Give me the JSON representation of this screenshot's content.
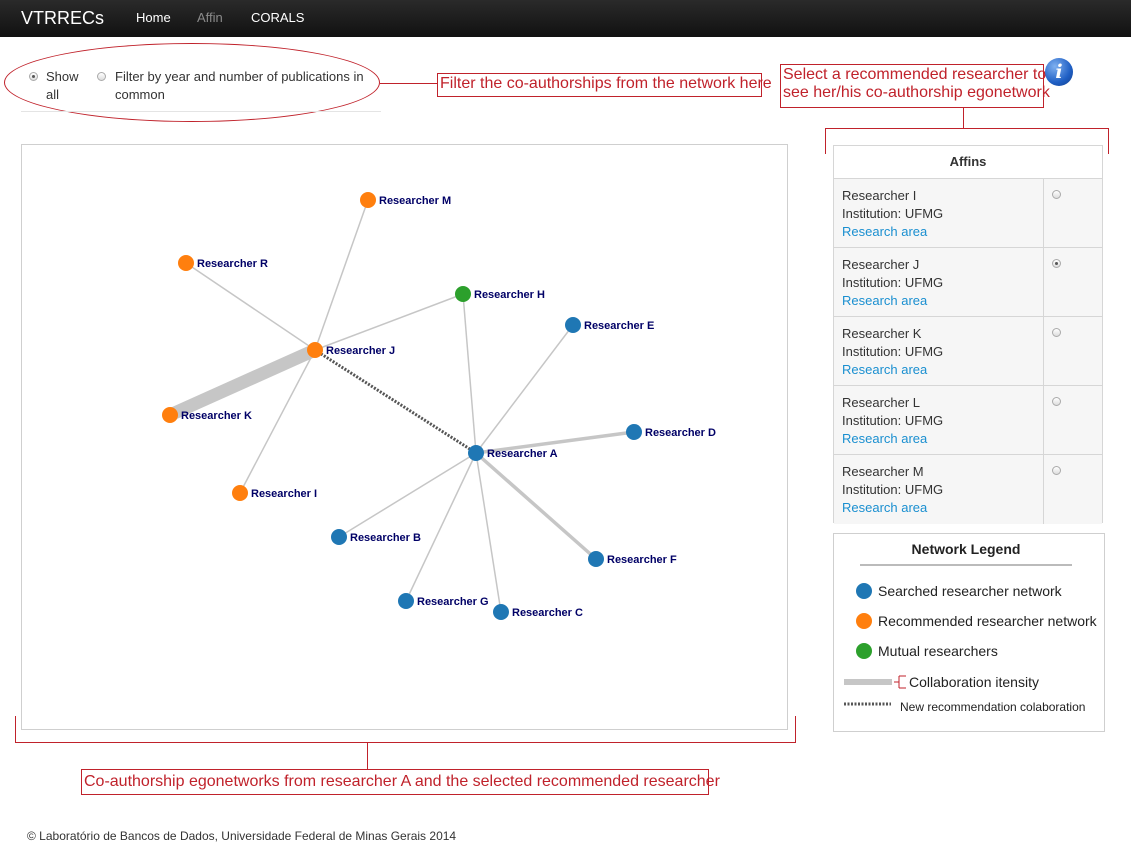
{
  "navbar": {
    "brand": "VTRRECs",
    "links": [
      {
        "label": "Home",
        "active": true
      },
      {
        "label": "Affin",
        "active": false
      },
      {
        "label": "CORALS",
        "active": true
      }
    ]
  },
  "filter": {
    "show_all_label_1": "Show",
    "show_all_label_2": "all",
    "filter_label_1": "Filter by year and number of publications in",
    "filter_label_2": "common",
    "selected": "show_all"
  },
  "annotations": {
    "filter_note": "Filter the co-authorships from the network here",
    "select_note_1": "Select a recommended researcher to",
    "select_note_2": "see her/his co-authorship egonetwork",
    "network_note": "Co-authorship egonetworks from researcher A and the selected recommended researcher"
  },
  "info_icon": {
    "glyph": "i",
    "icon": "info-icon"
  },
  "affins": {
    "title": "Affins",
    "rows": [
      {
        "name": "Researcher I",
        "institution": "Institution: UFMG",
        "area": "Research area",
        "selected": false
      },
      {
        "name": "Researcher J",
        "institution": "Institution: UFMG",
        "area": "Research area",
        "selected": true
      },
      {
        "name": "Researcher K",
        "institution": "Institution: UFMG",
        "area": "Research area",
        "selected": false
      },
      {
        "name": "Researcher L",
        "institution": "Institution: UFMG",
        "area": "Research area",
        "selected": false
      },
      {
        "name": "Researcher M",
        "institution": "Institution: UFMG",
        "area": "Research area",
        "selected": false
      }
    ]
  },
  "legend": {
    "title": "Network Legend",
    "searched": "Searched researcher network",
    "recommended": "Recommended researcher network",
    "mutual": "Mutual researchers",
    "intensity": "Collaboration itensity",
    "new_collab": "New recommendation colaboration"
  },
  "colors": {
    "searched": "#1f77b4",
    "recommended": "#ff7f0e",
    "mutual": "#2ca02c",
    "edge": "#c6c6c6",
    "recommendation_edge": "#555555",
    "annotation": "#c0222b",
    "label": "#000066"
  },
  "network": {
    "nodes": [
      {
        "id": "A",
        "label": "Researcher A",
        "group": "searched"
      },
      {
        "id": "B",
        "label": "Researcher B",
        "group": "searched"
      },
      {
        "id": "C",
        "label": "Researcher C",
        "group": "searched"
      },
      {
        "id": "D",
        "label": "Researcher D",
        "group": "searched"
      },
      {
        "id": "E",
        "label": "Researcher E",
        "group": "searched"
      },
      {
        "id": "F",
        "label": "Researcher F",
        "group": "searched"
      },
      {
        "id": "G",
        "label": "Researcher G",
        "group": "searched"
      },
      {
        "id": "H",
        "label": "Researcher H",
        "group": "mutual"
      },
      {
        "id": "I",
        "label": "Researcher I",
        "group": "recommended"
      },
      {
        "id": "J",
        "label": "Researcher J",
        "group": "recommended"
      },
      {
        "id": "K",
        "label": "Researcher K",
        "group": "recommended"
      },
      {
        "id": "M",
        "label": "Researcher M",
        "group": "recommended"
      },
      {
        "id": "R",
        "label": "Researcher R",
        "group": "recommended"
      }
    ],
    "edges": [
      {
        "source": "J",
        "target": "K",
        "weight": 6
      },
      {
        "source": "J",
        "target": "M",
        "weight": 1
      },
      {
        "source": "J",
        "target": "R",
        "weight": 1
      },
      {
        "source": "J",
        "target": "H",
        "weight": 1
      },
      {
        "source": "J",
        "target": "I",
        "weight": 1
      },
      {
        "source": "J",
        "target": "A",
        "weight": 1,
        "recommendation": true
      },
      {
        "source": "A",
        "target": "H",
        "weight": 1
      },
      {
        "source": "A",
        "target": "E",
        "weight": 1
      },
      {
        "source": "A",
        "target": "D",
        "weight": 2
      },
      {
        "source": "A",
        "target": "F",
        "weight": 2
      },
      {
        "source": "A",
        "target": "B",
        "weight": 1
      },
      {
        "source": "A",
        "target": "G",
        "weight": 1
      },
      {
        "source": "A",
        "target": "C",
        "weight": 1
      }
    ]
  },
  "footer": "© Laboratório de Bancos de Dados, Universidade Federal de Minas Gerais 2014"
}
